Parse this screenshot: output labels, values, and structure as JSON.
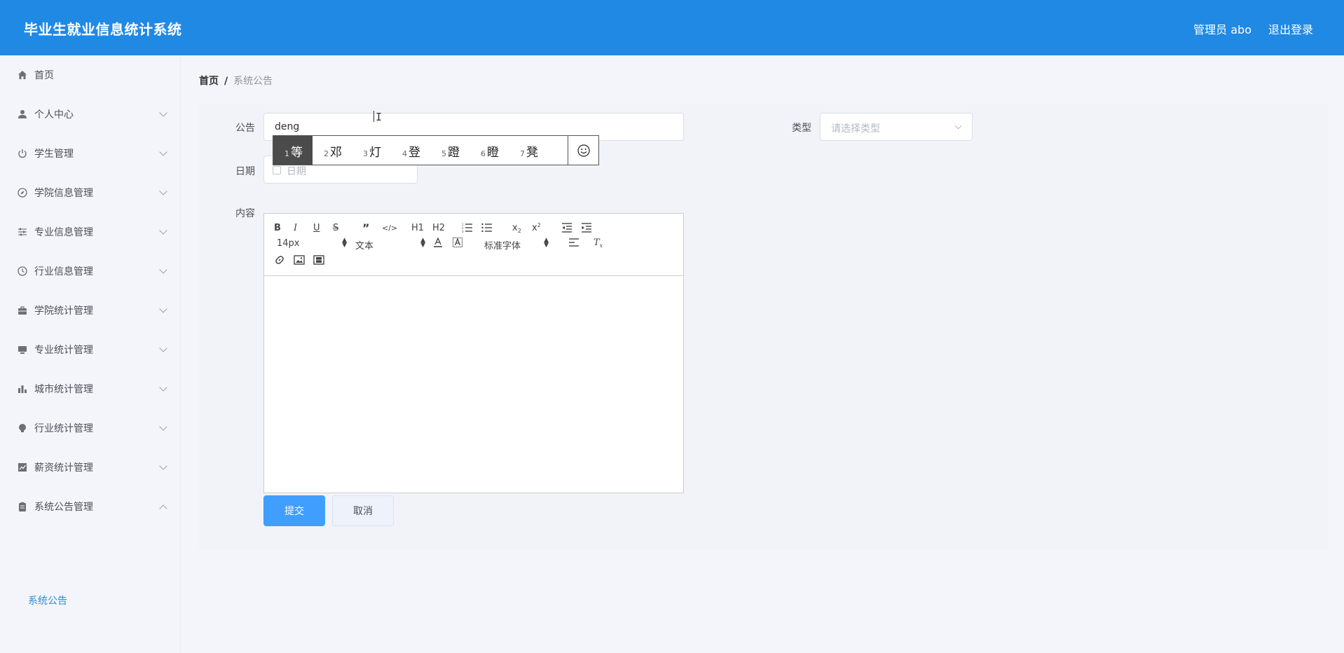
{
  "header": {
    "title": "毕业生就业信息统计系统",
    "user": "管理员 abo",
    "logout": "退出登录"
  },
  "sidebar": {
    "items": [
      {
        "label": "首页",
        "icon": "home-icon"
      },
      {
        "label": "个人中心",
        "icon": "user-icon"
      },
      {
        "label": "学生管理",
        "icon": "power-icon"
      },
      {
        "label": "学院信息管理",
        "icon": "compass-icon"
      },
      {
        "label": "专业信息管理",
        "icon": "sliders-icon"
      },
      {
        "label": "行业信息管理",
        "icon": "clock-icon"
      },
      {
        "label": "学院统计管理",
        "icon": "briefcase-icon"
      },
      {
        "label": "专业统计管理",
        "icon": "monitor-icon"
      },
      {
        "label": "城市统计管理",
        "icon": "bar-chart-icon"
      },
      {
        "label": "行业统计管理",
        "icon": "bulb-icon"
      },
      {
        "label": "薪资统计管理",
        "icon": "line-chart-icon"
      },
      {
        "label": "系统公告管理",
        "icon": "clipboard-icon"
      }
    ],
    "submenu": "系统公告"
  },
  "breadcrumb": {
    "home": "首页",
    "separator": "/",
    "current": "系统公告"
  },
  "form": {
    "title_label": "公告",
    "title_value": "deng",
    "type_label": "类型",
    "type_placeholder": "请选择类型",
    "date_label": "日期",
    "date_placeholder": "日期",
    "content_label": "内容",
    "submit": "提交",
    "cancel": "取消"
  },
  "ime": {
    "candidates": [
      {
        "num": "1",
        "char": "等"
      },
      {
        "num": "2",
        "char": "邓"
      },
      {
        "num": "3",
        "char": "灯"
      },
      {
        "num": "4",
        "char": "登"
      },
      {
        "num": "5",
        "char": "蹬"
      },
      {
        "num": "6",
        "char": "瞪"
      },
      {
        "num": "7",
        "char": "凳"
      }
    ]
  },
  "editor": {
    "size": "14px",
    "header": "文本",
    "font": "标准字体",
    "h1": "H1",
    "h2": "H2"
  },
  "colors": {
    "header_bg": "#2089e4",
    "primary": "#409eff",
    "active_submenu": "#2b8bd8"
  }
}
